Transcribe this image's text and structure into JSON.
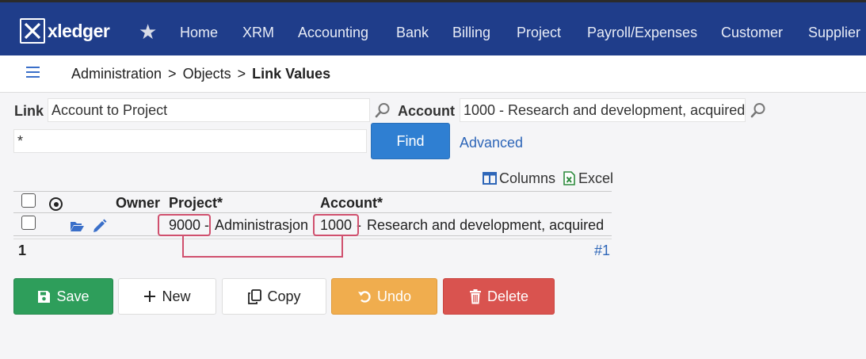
{
  "header": {
    "logo_text": "xledger",
    "nav": [
      "Home",
      "XRM",
      "Accounting",
      "Bank",
      "Billing",
      "Project",
      "Payroll/Expenses",
      "Customer",
      "Supplier"
    ]
  },
  "breadcrumb": {
    "items": [
      "Administration",
      "Objects",
      "Link Values"
    ],
    "separator": ">"
  },
  "filters": {
    "link_label": "Link",
    "link_value": "Account to Project",
    "account_label": "Account",
    "account_value": "1000 - Research and development, acquired",
    "search_value": "*",
    "find_label": "Find",
    "advanced_label": "Advanced"
  },
  "toolbar": {
    "columns_label": "Columns",
    "excel_label": "Excel"
  },
  "table": {
    "columns": [
      "Owner",
      "Project*",
      "Account*"
    ],
    "rows": [
      {
        "project_code": "9000",
        "project_sep": "-",
        "project_name": "Administrasjon",
        "account_code": "1000",
        "account_sep": "-",
        "account_name": "Research and development, acquired"
      }
    ],
    "row_count": "1",
    "page_label": "#1"
  },
  "actions": {
    "save": "Save",
    "new": "New",
    "copy": "Copy",
    "undo": "Undo",
    "delete": "Delete"
  },
  "colors": {
    "topbar": "#1f3d8a",
    "find": "#2f7fd2",
    "save": "#2e9e5b",
    "undo": "#f0ad4e",
    "delete": "#d9534f",
    "highlight": "#d0506e"
  }
}
